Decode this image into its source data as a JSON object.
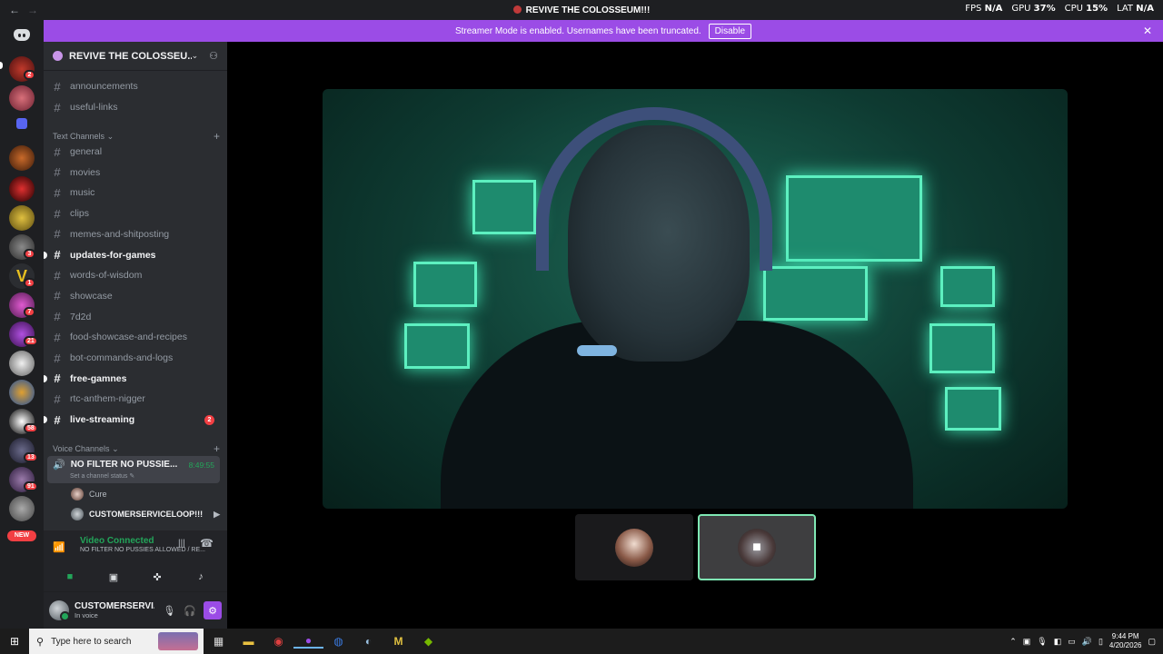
{
  "window": {
    "title": "REVIVE THE COLOSSEUM!!!"
  },
  "overlay": {
    "fps_label": "FPS",
    "fps_value": "N/A",
    "gpu_label": "GPU",
    "gpu_value": "37%",
    "cpu_label": "CPU",
    "cpu_value": "15%",
    "lat_label": "LAT",
    "lat_value": "N/A"
  },
  "banner": {
    "text": "Streamer Mode is enabled. Usernames have been truncated.",
    "button": "Disable"
  },
  "guild": {
    "name": "REVIVE THE COLOSSEU..."
  },
  "channels_top": [
    "announcements",
    "useful-links"
  ],
  "categories": {
    "text": "Text Channels",
    "voice": "Voice Channels"
  },
  "text_channels": [
    {
      "name": "general",
      "unread": false,
      "badge": ""
    },
    {
      "name": "movies",
      "unread": false,
      "badge": ""
    },
    {
      "name": "music",
      "unread": false,
      "badge": ""
    },
    {
      "name": "clips",
      "unread": false,
      "badge": ""
    },
    {
      "name": "memes-and-shitposting",
      "unread": false,
      "badge": ""
    },
    {
      "name": "updates-for-games",
      "unread": true,
      "badge": ""
    },
    {
      "name": "words-of-wisdom",
      "unread": false,
      "badge": ""
    },
    {
      "name": "showcase",
      "unread": false,
      "badge": ""
    },
    {
      "name": "7d2d",
      "unread": false,
      "badge": ""
    },
    {
      "name": "food-showcase-and-recipes",
      "unread": false,
      "badge": ""
    },
    {
      "name": "bot-commands-and-logs",
      "unread": false,
      "badge": ""
    },
    {
      "name": "free-gamnes",
      "unread": true,
      "badge": ""
    },
    {
      "name": "rtc-anthem-nigger",
      "unread": false,
      "badge": ""
    },
    {
      "name": "live-streaming",
      "unread": true,
      "badge": "2"
    }
  ],
  "voice_channel": {
    "name": "NO FILTER NO PUSSIE...",
    "timer": "8:49:55",
    "status_placeholder": "Set a channel status"
  },
  "voice_users": [
    {
      "name": "Cure",
      "self": false
    },
    {
      "name": "CUSTOMERSERVICELOOP!!!",
      "self": true
    }
  ],
  "rtc": {
    "title": "Video Connected",
    "subtitle": "NO FILTER NO PUSSIES ALLOWED / RE..."
  },
  "user": {
    "name": "CUSTOMERSERVI...",
    "status": "In voice"
  },
  "server_badges": [
    "2",
    "3",
    "1",
    "7",
    "21",
    "58",
    "13",
    "91"
  ],
  "new_badge": "NEW",
  "taskbar": {
    "search_placeholder": "Type here to search",
    "time": "9:44 PM",
    "date": "4/20/2026"
  },
  "colors": {
    "accent": "#9b4ce6",
    "voice_green": "#23a55a",
    "mention_red": "#f23f43",
    "video_bg": "#1d6a57"
  }
}
